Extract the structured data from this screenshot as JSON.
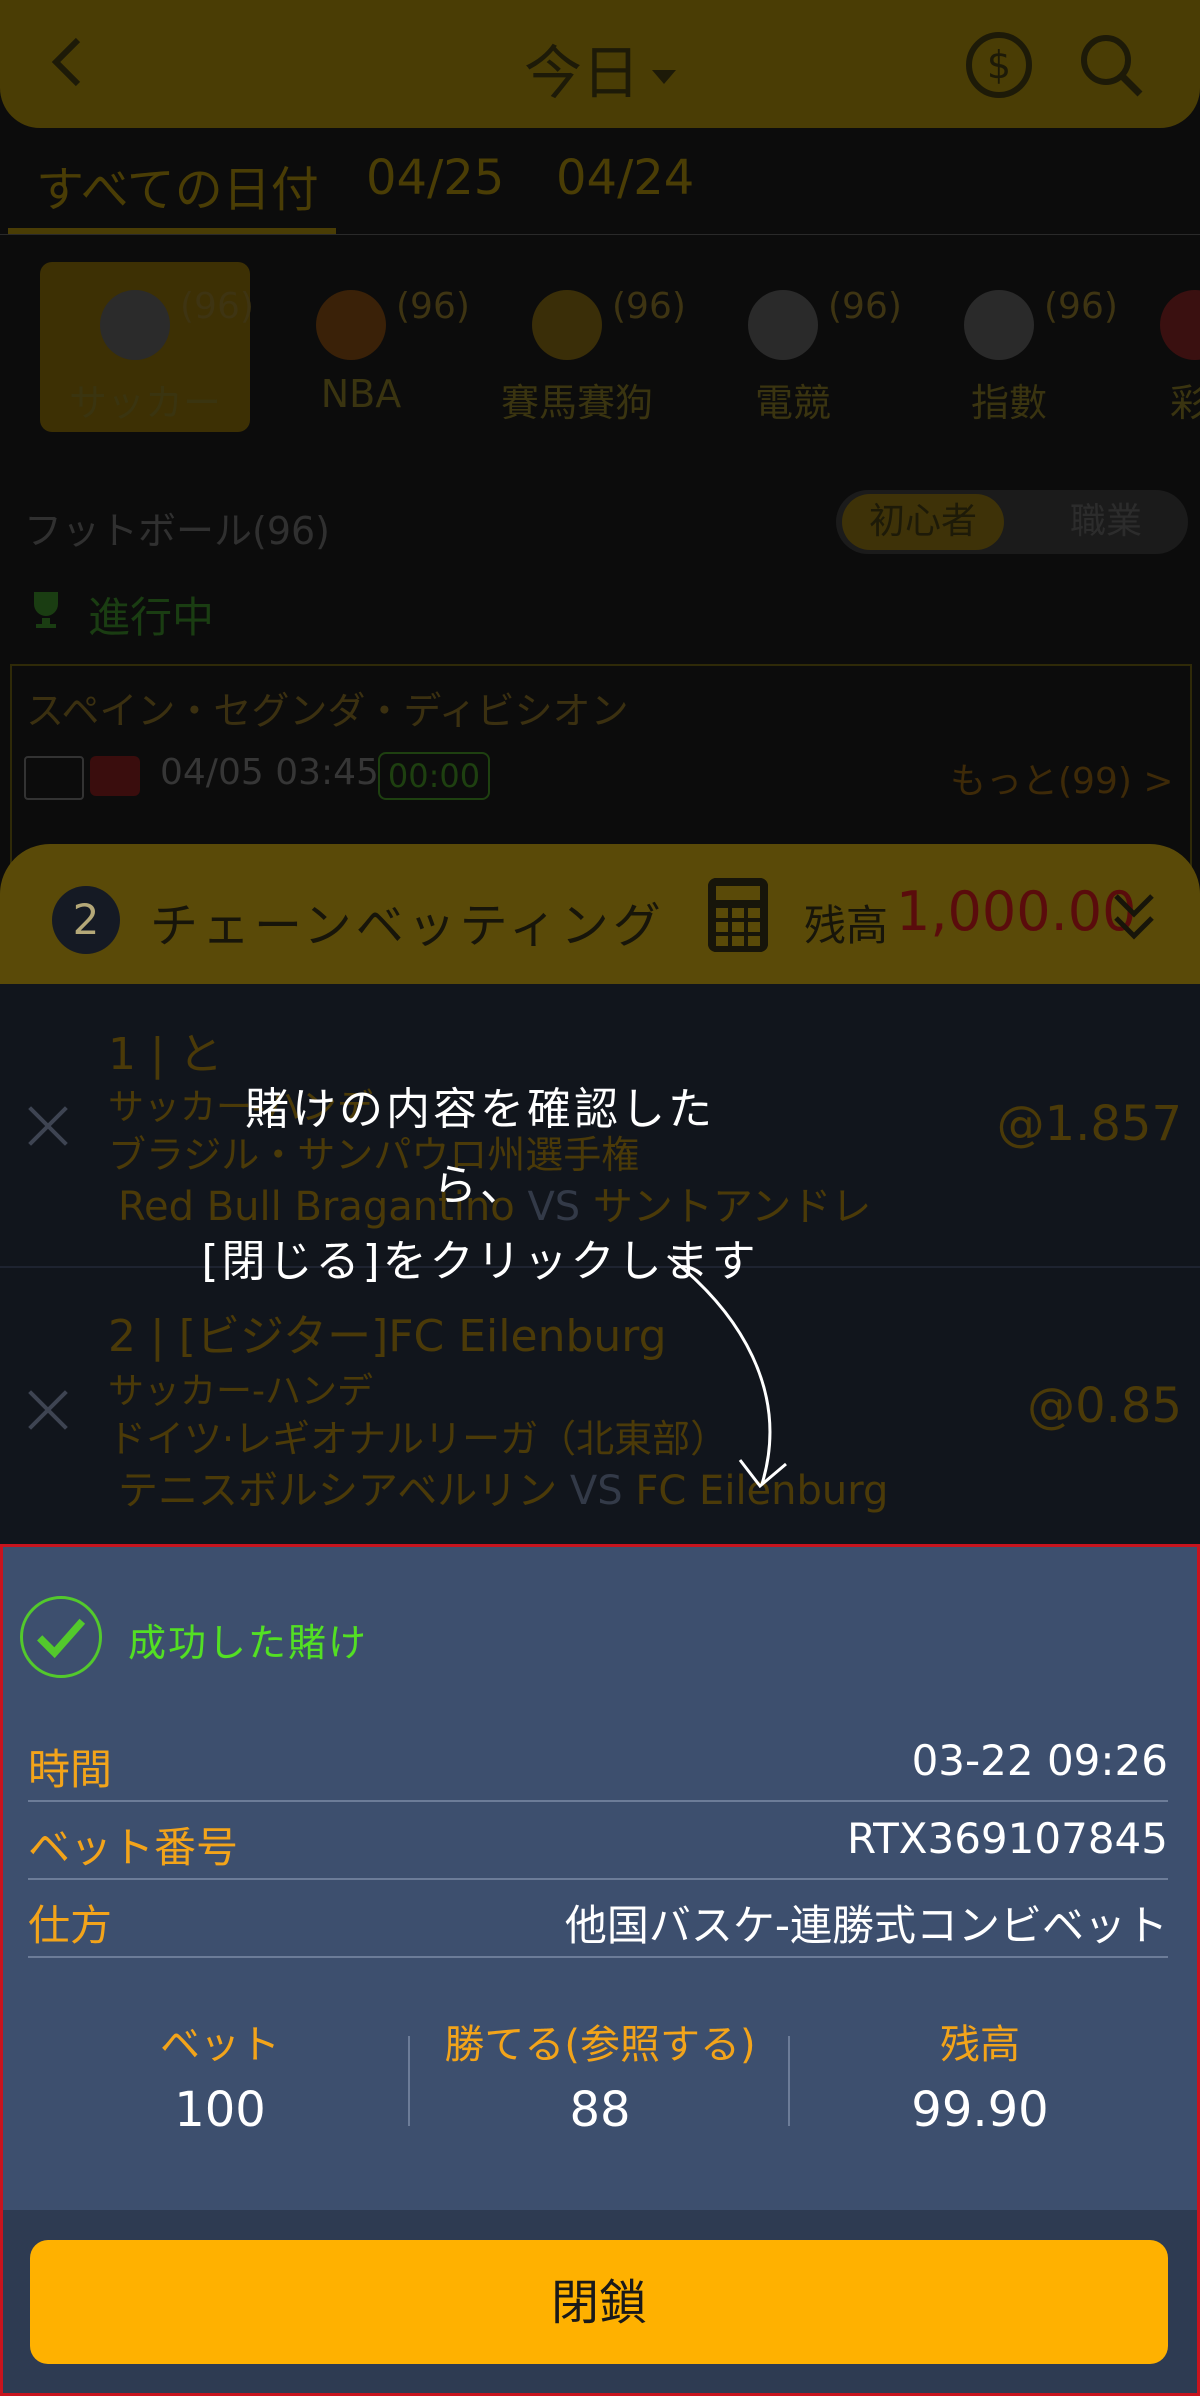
{
  "header": {
    "title": "今日",
    "back_icon": "chevron-left-icon",
    "currency_icon": "dollar-circle-icon",
    "search_icon": "search-icon"
  },
  "date_tabs": [
    {
      "label": "すべての日付",
      "active": true
    },
    {
      "label": "04/25",
      "active": false
    },
    {
      "label": "04/24",
      "active": false
    }
  ],
  "sports": [
    {
      "label": "サッカー",
      "count": "(96)",
      "icon": "soccer-ball-icon",
      "active": true
    },
    {
      "label": "NBA",
      "count": "(96)",
      "icon": "basketball-icon",
      "active": false
    },
    {
      "label": "賽馬賽狗",
      "count": "(96)",
      "icon": "horseshoe-icon",
      "active": false
    },
    {
      "label": "電競",
      "count": "(96)",
      "icon": "gamepad-icon",
      "active": false
    },
    {
      "label": "指數",
      "count": "(96)",
      "icon": "bar-chart-icon",
      "active": false
    },
    {
      "label": "彩",
      "count": "",
      "icon": "lottery-icon",
      "active": false
    }
  ],
  "section": {
    "label": "フットボール(96)",
    "mode_on": "初心者",
    "mode_off": "職業"
  },
  "live": {
    "label": "進行中"
  },
  "match": {
    "league": "スペイン・セグンダ・ディビシオン",
    "time": "04/05 03:45",
    "clock": "00:00",
    "more": "もっと(99) >"
  },
  "bet_slip": {
    "count": "2",
    "title": "チェーンベッティング",
    "balance_label": "残高",
    "balance_value": "1,000.00",
    "items": [
      {
        "line1": "1 | と",
        "line2": "サッカー-ハンデ",
        "line3": "ブラジル・サンパウロ州選手権",
        "home": "Red Bull Bragantino",
        "vs": "VS",
        "away": "サントアンドレ",
        "odds": "@1.857"
      },
      {
        "line1": "2 | [ビジター]FC Eilenburg",
        "line2": "サッカー-ハンデ",
        "line3": "ドイツ·レギオナルリーガ（北東部）",
        "home": "テニスボルシアベルリン",
        "vs": "VS",
        "away": "FC Eilenburg",
        "odds": "@0.85"
      }
    ]
  },
  "tooltip": {
    "line1": "賭けの内容を確認したら、",
    "line2": "[閉じる]をクリックします"
  },
  "success": {
    "status": "成功した賭け",
    "rows": [
      {
        "key": "時間",
        "value": "03-22 09:26"
      },
      {
        "key": "ベット番号",
        "value": "RTX369107845"
      },
      {
        "key": "仕方",
        "value": "他国バスケ-連勝式コンビベット"
      }
    ],
    "stats": [
      {
        "key": "ベット",
        "value": "100"
      },
      {
        "key": "勝てる(参照する)",
        "value": "88"
      },
      {
        "key": "残高",
        "value": "99.90"
      }
    ],
    "close_label": "閉鎖"
  },
  "colors": {
    "accent": "#ffb100",
    "panel": "#3d4f6e",
    "success_green": "#53e023",
    "highlight_border": "#c8141e"
  }
}
